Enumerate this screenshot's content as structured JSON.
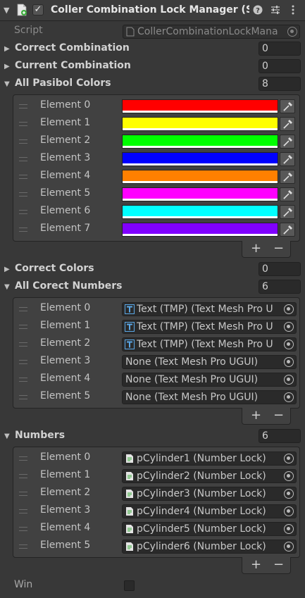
{
  "header": {
    "title": "Coller Combination Lock Manager (Sc",
    "enabled_check": "✓"
  },
  "script": {
    "label": "Script",
    "value": "CollerCombinationLockMana"
  },
  "correct_combination": {
    "label": "Correct Combination",
    "value": "0"
  },
  "current_combination": {
    "label": "Current Combination",
    "value": "0"
  },
  "all_pasibol_colors": {
    "label": "All Pasibol Colors",
    "size": "8",
    "elements": [
      {
        "label": "Element 0",
        "color": "#ff0000"
      },
      {
        "label": "Element 1",
        "color": "#ffff00"
      },
      {
        "label": "Element 2",
        "color": "#00ff00"
      },
      {
        "label": "Element 3",
        "color": "#0000ff"
      },
      {
        "label": "Element 4",
        "color": "#ff8000"
      },
      {
        "label": "Element 5",
        "color": "#ff00ff"
      },
      {
        "label": "Element 6",
        "color": "#00ffff"
      },
      {
        "label": "Element 7",
        "color": "#8000ff"
      }
    ]
  },
  "correct_colors": {
    "label": "Correct Colors",
    "value": "0"
  },
  "all_corect_numbers": {
    "label": "All Corect Numbers",
    "size": "6",
    "elements": [
      {
        "label": "Element 0",
        "value": "Text (TMP) (Text Mesh Pro U",
        "icon": "tmp-text-icon"
      },
      {
        "label": "Element 1",
        "value": "Text (TMP) (Text Mesh Pro U",
        "icon": "tmp-text-icon"
      },
      {
        "label": "Element 2",
        "value": "Text (TMP) (Text Mesh Pro U",
        "icon": "tmp-text-icon"
      },
      {
        "label": "Element 3",
        "value": "None (Text Mesh Pro UGUI)",
        "icon": ""
      },
      {
        "label": "Element 4",
        "value": "None (Text Mesh Pro UGUI)",
        "icon": ""
      },
      {
        "label": "Element 5",
        "value": "None (Text Mesh Pro UGUI)",
        "icon": ""
      }
    ]
  },
  "numbers": {
    "label": "Numbers",
    "size": "6",
    "elements": [
      {
        "label": "Element 0",
        "value": "pCylinder1 (Number Lock)",
        "icon": "script-file-icon"
      },
      {
        "label": "Element 1",
        "value": "pCylinder2 (Number Lock)",
        "icon": "script-file-icon"
      },
      {
        "label": "Element 2",
        "value": "pCylinder3 (Number Lock)",
        "icon": "script-file-icon"
      },
      {
        "label": "Element 3",
        "value": "pCylinder4 (Number Lock)",
        "icon": "script-file-icon"
      },
      {
        "label": "Element 4",
        "value": "pCylinder5 (Number Lock)",
        "icon": "script-file-icon"
      },
      {
        "label": "Element 5",
        "value": "pCylinder6 (Number Lock)",
        "icon": "script-file-icon"
      }
    ]
  },
  "win": {
    "label": "Win",
    "checked": false
  },
  "list_controls": {
    "add": "+",
    "remove": "−"
  },
  "theme": {
    "panel_bg": "#383838",
    "field_bg": "#2a2a2a",
    "list_bg": "#414141"
  }
}
